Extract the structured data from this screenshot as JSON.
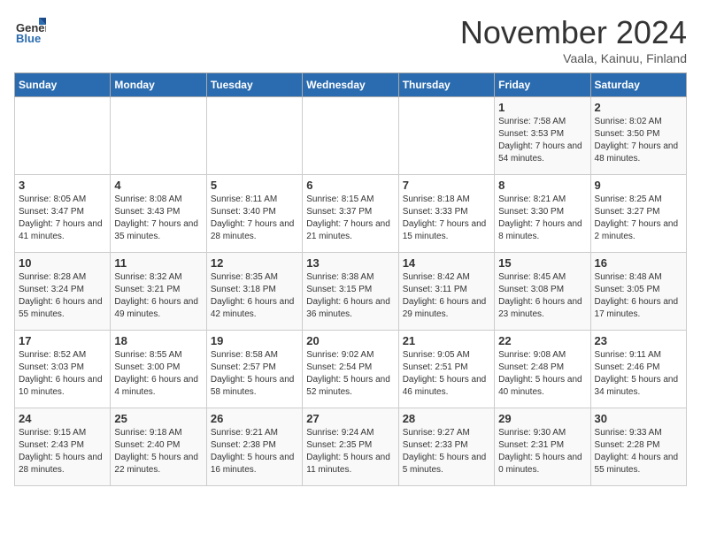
{
  "logo": {
    "general": "General",
    "blue": "Blue"
  },
  "title": "November 2024",
  "subtitle": "Vaala, Kainuu, Finland",
  "headers": [
    "Sunday",
    "Monday",
    "Tuesday",
    "Wednesday",
    "Thursday",
    "Friday",
    "Saturday"
  ],
  "weeks": [
    [
      {
        "day": "",
        "info": ""
      },
      {
        "day": "",
        "info": ""
      },
      {
        "day": "",
        "info": ""
      },
      {
        "day": "",
        "info": ""
      },
      {
        "day": "",
        "info": ""
      },
      {
        "day": "1",
        "info": "Sunrise: 7:58 AM\nSunset: 3:53 PM\nDaylight: 7 hours\nand 54 minutes."
      },
      {
        "day": "2",
        "info": "Sunrise: 8:02 AM\nSunset: 3:50 PM\nDaylight: 7 hours\nand 48 minutes."
      }
    ],
    [
      {
        "day": "3",
        "info": "Sunrise: 8:05 AM\nSunset: 3:47 PM\nDaylight: 7 hours\nand 41 minutes."
      },
      {
        "day": "4",
        "info": "Sunrise: 8:08 AM\nSunset: 3:43 PM\nDaylight: 7 hours\nand 35 minutes."
      },
      {
        "day": "5",
        "info": "Sunrise: 8:11 AM\nSunset: 3:40 PM\nDaylight: 7 hours\nand 28 minutes."
      },
      {
        "day": "6",
        "info": "Sunrise: 8:15 AM\nSunset: 3:37 PM\nDaylight: 7 hours\nand 21 minutes."
      },
      {
        "day": "7",
        "info": "Sunrise: 8:18 AM\nSunset: 3:33 PM\nDaylight: 7 hours\nand 15 minutes."
      },
      {
        "day": "8",
        "info": "Sunrise: 8:21 AM\nSunset: 3:30 PM\nDaylight: 7 hours\nand 8 minutes."
      },
      {
        "day": "9",
        "info": "Sunrise: 8:25 AM\nSunset: 3:27 PM\nDaylight: 7 hours\nand 2 minutes."
      }
    ],
    [
      {
        "day": "10",
        "info": "Sunrise: 8:28 AM\nSunset: 3:24 PM\nDaylight: 6 hours\nand 55 minutes."
      },
      {
        "day": "11",
        "info": "Sunrise: 8:32 AM\nSunset: 3:21 PM\nDaylight: 6 hours\nand 49 minutes."
      },
      {
        "day": "12",
        "info": "Sunrise: 8:35 AM\nSunset: 3:18 PM\nDaylight: 6 hours\nand 42 minutes."
      },
      {
        "day": "13",
        "info": "Sunrise: 8:38 AM\nSunset: 3:15 PM\nDaylight: 6 hours\nand 36 minutes."
      },
      {
        "day": "14",
        "info": "Sunrise: 8:42 AM\nSunset: 3:11 PM\nDaylight: 6 hours\nand 29 minutes."
      },
      {
        "day": "15",
        "info": "Sunrise: 8:45 AM\nSunset: 3:08 PM\nDaylight: 6 hours\nand 23 minutes."
      },
      {
        "day": "16",
        "info": "Sunrise: 8:48 AM\nSunset: 3:05 PM\nDaylight: 6 hours\nand 17 minutes."
      }
    ],
    [
      {
        "day": "17",
        "info": "Sunrise: 8:52 AM\nSunset: 3:03 PM\nDaylight: 6 hours\nand 10 minutes."
      },
      {
        "day": "18",
        "info": "Sunrise: 8:55 AM\nSunset: 3:00 PM\nDaylight: 6 hours\nand 4 minutes."
      },
      {
        "day": "19",
        "info": "Sunrise: 8:58 AM\nSunset: 2:57 PM\nDaylight: 5 hours\nand 58 minutes."
      },
      {
        "day": "20",
        "info": "Sunrise: 9:02 AM\nSunset: 2:54 PM\nDaylight: 5 hours\nand 52 minutes."
      },
      {
        "day": "21",
        "info": "Sunrise: 9:05 AM\nSunset: 2:51 PM\nDaylight: 5 hours\nand 46 minutes."
      },
      {
        "day": "22",
        "info": "Sunrise: 9:08 AM\nSunset: 2:48 PM\nDaylight: 5 hours\nand 40 minutes."
      },
      {
        "day": "23",
        "info": "Sunrise: 9:11 AM\nSunset: 2:46 PM\nDaylight: 5 hours\nand 34 minutes."
      }
    ],
    [
      {
        "day": "24",
        "info": "Sunrise: 9:15 AM\nSunset: 2:43 PM\nDaylight: 5 hours\nand 28 minutes."
      },
      {
        "day": "25",
        "info": "Sunrise: 9:18 AM\nSunset: 2:40 PM\nDaylight: 5 hours\nand 22 minutes."
      },
      {
        "day": "26",
        "info": "Sunrise: 9:21 AM\nSunset: 2:38 PM\nDaylight: 5 hours\nand 16 minutes."
      },
      {
        "day": "27",
        "info": "Sunrise: 9:24 AM\nSunset: 2:35 PM\nDaylight: 5 hours\nand 11 minutes."
      },
      {
        "day": "28",
        "info": "Sunrise: 9:27 AM\nSunset: 2:33 PM\nDaylight: 5 hours\nand 5 minutes."
      },
      {
        "day": "29",
        "info": "Sunrise: 9:30 AM\nSunset: 2:31 PM\nDaylight: 5 hours\nand 0 minutes."
      },
      {
        "day": "30",
        "info": "Sunrise: 9:33 AM\nSunset: 2:28 PM\nDaylight: 4 hours\nand 55 minutes."
      }
    ]
  ]
}
